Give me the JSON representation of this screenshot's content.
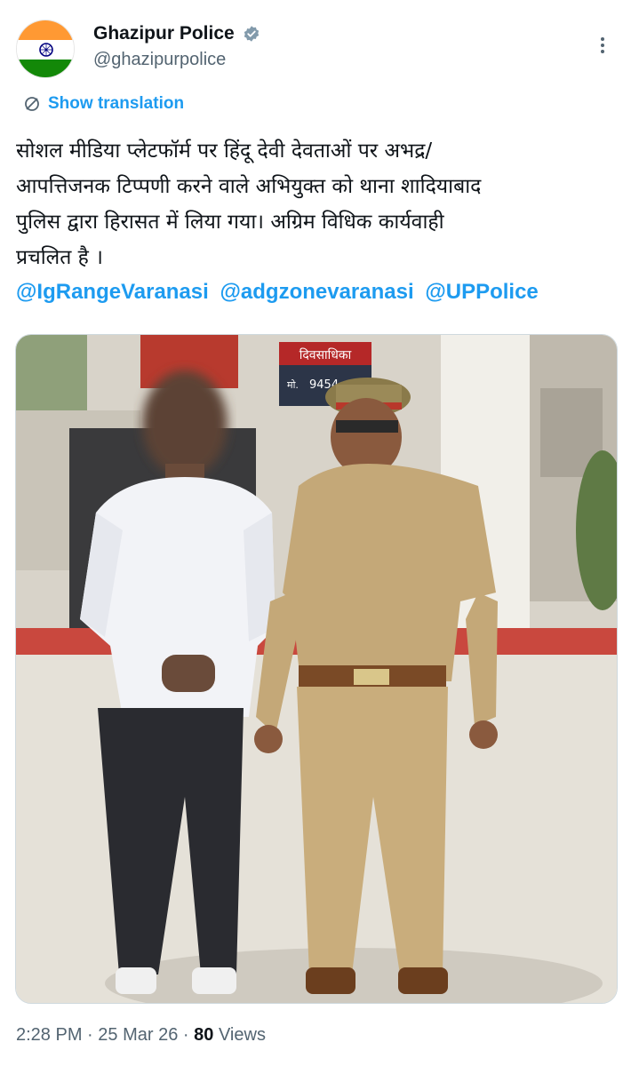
{
  "account": {
    "display_name": "Ghazipur Police",
    "handle": "@ghazipurpolice",
    "verified_icon": "verified-badge-icon",
    "avatar_icon": "indian-flag-avatar"
  },
  "translate_label": "Show translation",
  "tweet": {
    "lines": [
      "सोशल मीडिया प्लेटफॉर्म पर हिंदू देवी देवताओं पर अभद्र/",
      "आपत्तिजनक टिप्पणी करने वाले अभियुक्त को थाना शादियाबाद",
      "पुलिस द्वारा हिरासत में लिया गया। अग्रिम विधिक कार्यवाही",
      "प्रचलित है ।"
    ],
    "mentions": [
      "@IgRangeVaranasi",
      "@adgzonevaranasi",
      "@UPPolice"
    ]
  },
  "media": {
    "sign_text": "दिवसाधिका",
    "sign_number": "9454",
    "sign_prefix": "मो."
  },
  "meta": {
    "time": "2:28 PM",
    "separator": "·",
    "date": "25 Mar 26",
    "views_count": "80",
    "views_label": "Views"
  },
  "colors": {
    "link": "#1d9bf0",
    "secondary_text": "#536471",
    "verified": "#829aab",
    "flag_saffron": "#ff9933",
    "flag_green": "#138808",
    "flag_chakra": "#000080"
  }
}
